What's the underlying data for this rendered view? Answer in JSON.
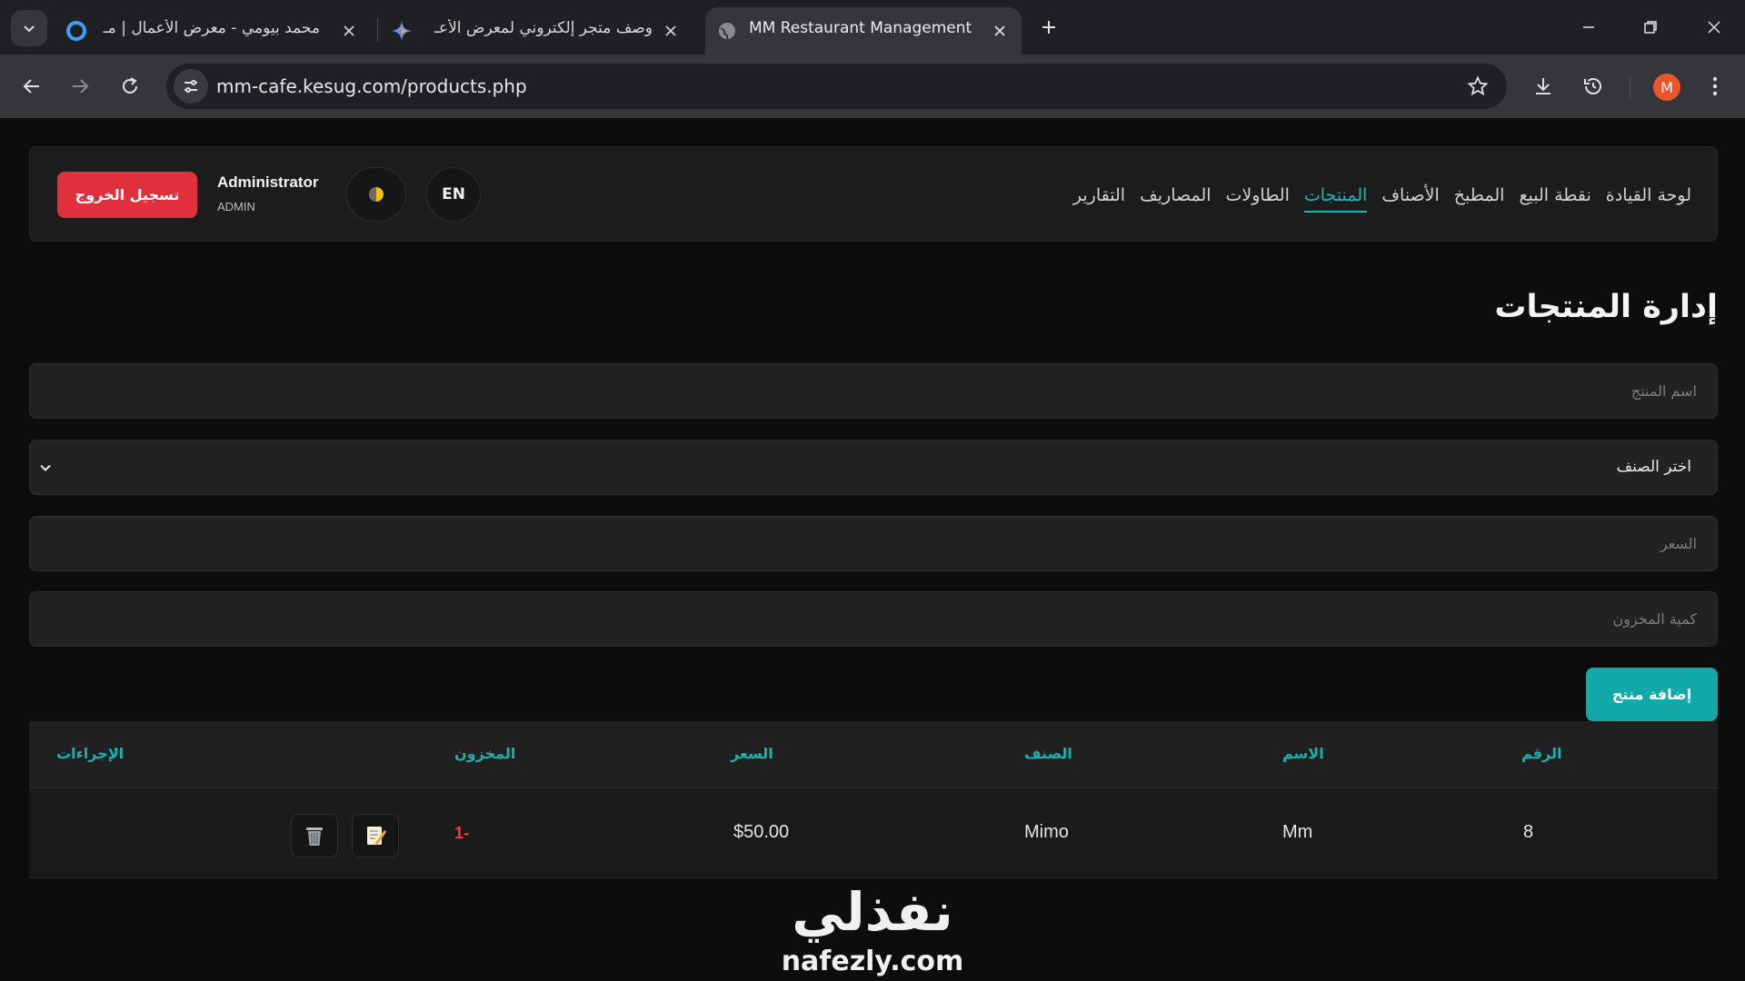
{
  "browser": {
    "tabs": [
      {
        "title": "محمد بيومي - معرض الأعمال | مـ",
        "active": false
      },
      {
        "title": "وصف متجر إلكتروني لمعرض الأعـ",
        "active": false
      },
      {
        "title": "MM Restaurant Management",
        "active": true
      }
    ],
    "url": "mm-cafe.kesug.com/products.php",
    "profile_initial": "M"
  },
  "nav": {
    "menu": [
      {
        "label": "لوحة القيادة",
        "active": false
      },
      {
        "label": "نقطة البيع",
        "active": false
      },
      {
        "label": "المطبخ",
        "active": false
      },
      {
        "label": "الأصناف",
        "active": false
      },
      {
        "label": "المنتجات",
        "active": true
      },
      {
        "label": "الطاولات",
        "active": false
      },
      {
        "label": "المصاريف",
        "active": false
      },
      {
        "label": "التقارير",
        "active": false
      }
    ],
    "lang_label": "EN",
    "user_name": "Administrator",
    "user_role": "ADMIN",
    "logout_label": "تسجيل الخروج"
  },
  "page": {
    "title": "إدارة المنتجات",
    "form": {
      "name_placeholder": "اسم المنتج",
      "category_value": "اختر الصنف",
      "price_placeholder": "السعر",
      "stock_placeholder": "كمية المخزون",
      "add_label": "إضافة منتج"
    },
    "table": {
      "headers": {
        "id": "الرقم",
        "name": "الاسم",
        "category": "الصنف",
        "price": "السعر",
        "stock": "المخزون",
        "actions": "الإجراءات"
      },
      "rows": [
        {
          "id": "8",
          "name": "Mm",
          "category": "Mimo",
          "price": "$50.00",
          "stock": "1-"
        }
      ]
    }
  },
  "watermark": {
    "arabic": "نفذلي",
    "latin": "nafezly.com"
  },
  "colors": {
    "accent": "#17b8b6",
    "danger": "#e0303e",
    "profile": "#e8562a"
  }
}
